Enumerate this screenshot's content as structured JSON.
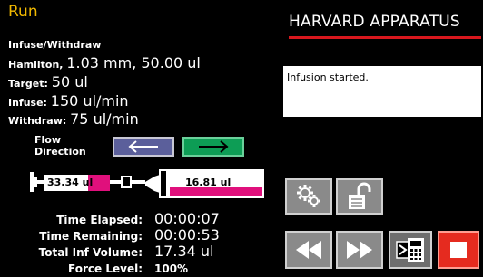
{
  "header": {
    "title": "Run",
    "brand": "HARVARD APPARATUS"
  },
  "info": {
    "mode": "Infuse/Withdraw",
    "syringe_prefix": "Hamilton,",
    "syringe_value": "1.03 mm, 50.00 ul",
    "target_label": "Target:",
    "target_value": "50 ul",
    "infuse_label": "Infuse:",
    "infuse_value": "150 ul/min",
    "withdraw_label": "Withdraw:",
    "withdraw_value": "75 ul/min"
  },
  "message": "Infusion started.",
  "flow": {
    "label_line1": "Flow",
    "label_line2": "Direction"
  },
  "syringe": {
    "left_volume": "33.34 ul",
    "right_volume": "16.81 ul",
    "left_fill_fraction": 0.34,
    "right_fill_fraction": 0.34,
    "fill_color": "#e0107c"
  },
  "stats": {
    "time_elapsed_label": "Time Elapsed:",
    "time_elapsed_value": "00:00:07",
    "time_remaining_label": "Time Remaining:",
    "time_remaining_value": "00:00:53",
    "total_volume_label": "Total Inf Volume:",
    "total_volume_value": "17.34 ul",
    "force_label": "Force Level:",
    "force_value": "100%"
  },
  "buttons": {
    "settings": "gears-icon",
    "unlock": "unlock-icon",
    "rewind": "rewind-icon",
    "fast_forward": "fast-forward-icon",
    "program": "program-icon",
    "stop": "stop-icon"
  },
  "colors": {
    "title": "#f0b800",
    "brand_line": "#d8171d",
    "left_arrow_btn": "#5b5f9b",
    "right_arrow_btn": "#0d9d55",
    "stop": "#e52b1f"
  }
}
